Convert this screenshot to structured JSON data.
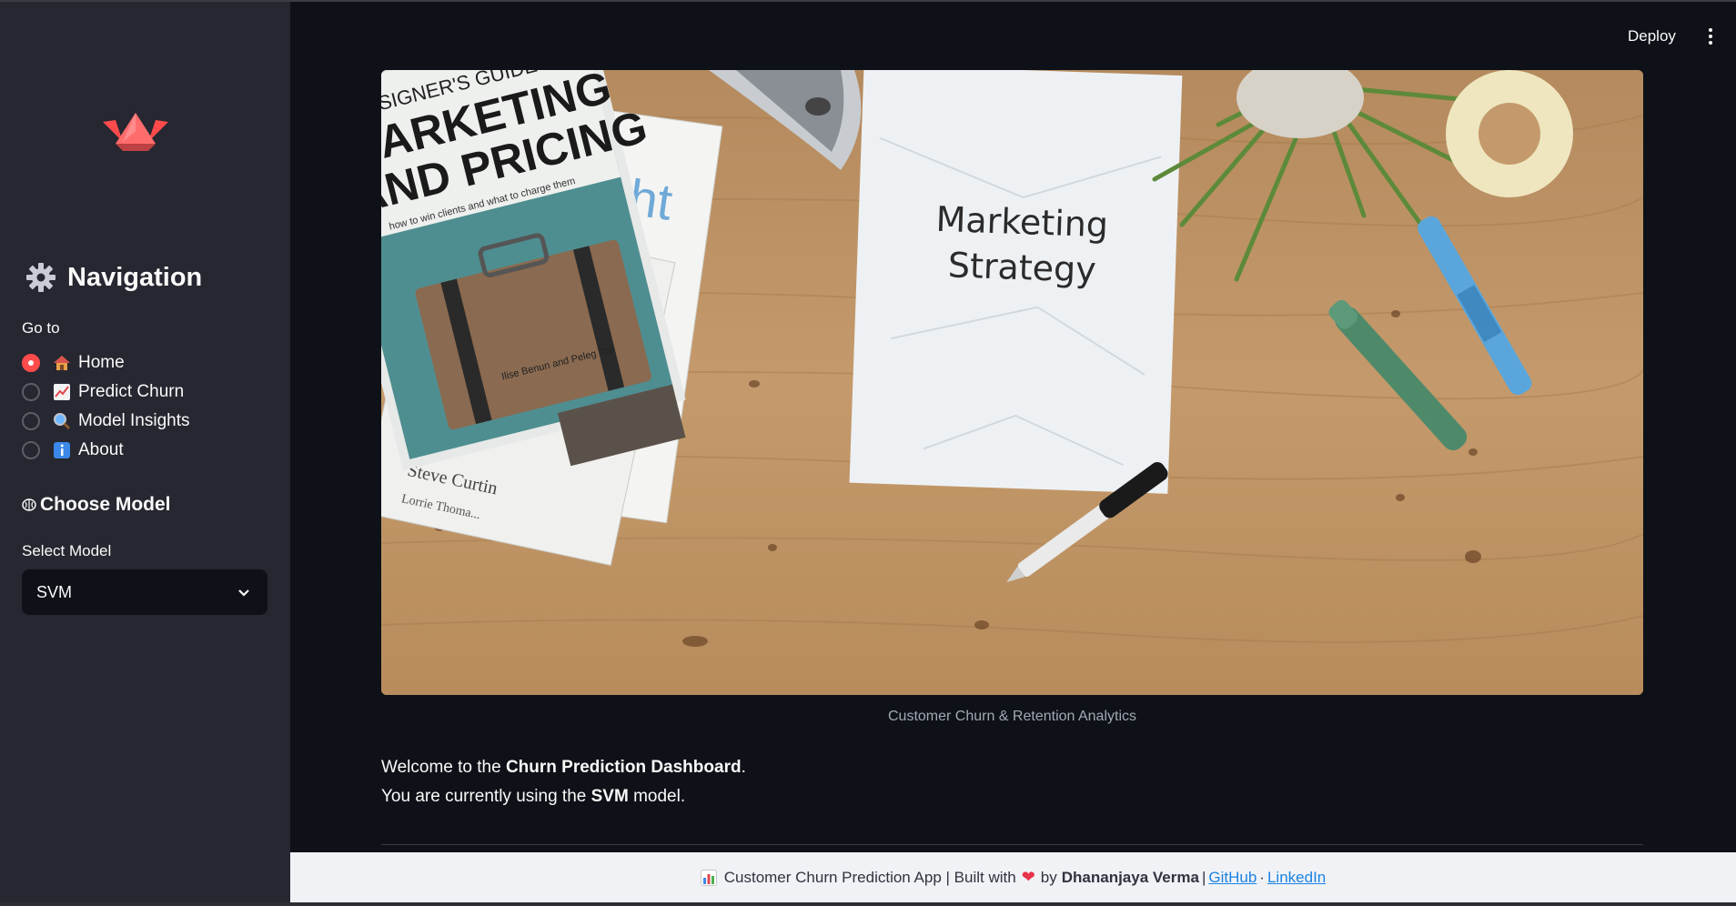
{
  "header": {
    "deploy_label": "Deploy"
  },
  "sidebar": {
    "nav_title": "Navigation",
    "goto_label": "Go to",
    "radio_items": [
      {
        "emoji": "house-icon",
        "label": "Home",
        "checked": true
      },
      {
        "emoji": "chart-increasing-icon",
        "label": "Predict Churn",
        "checked": false
      },
      {
        "emoji": "magnifier-icon",
        "label": "Model Insights",
        "checked": false
      },
      {
        "emoji": "info-icon",
        "label": "About",
        "checked": false
      }
    ],
    "choose_model_title": "Choose Model",
    "select_label": "Select Model",
    "selected_model": "SVM"
  },
  "main": {
    "hero_image": {
      "book_title_line1": "E DESIGNER'S GUIDE",
      "book_title_line2": "MARKETING",
      "book_title_line3": "AND PRICING",
      "book_subtitle": "how to win clients and what to charge them",
      "book_authors": "Ilise Benun and Peleg Top",
      "back_book_author": "Steve Curtin",
      "back_book_author2": "Lorrie Thoma...",
      "back_book_partial": "ht",
      "paper_line1": "Marketing",
      "paper_line2": "Strategy"
    },
    "caption": "Customer Churn & Retention Analytics",
    "welcome_prefix": "Welcome to the ",
    "welcome_bold": "Churn Prediction Dashboard",
    "welcome_suffix": ".",
    "using_prefix": "You are currently using the ",
    "using_bold": "SVM",
    "using_suffix": " model."
  },
  "footer": {
    "text_prefix": "Customer Churn Prediction App | Built with",
    "by_text": "by",
    "author": "Dhananjaya Verma",
    "pipe": "|",
    "github_label": "GitHub",
    "dot": "·",
    "linkedin_label": "LinkedIn"
  },
  "colors": {
    "accent": "#ff4b4b",
    "sidebar_bg": "#262730",
    "main_bg": "#0e1117",
    "footer_bg": "#f0f2f6",
    "link": "#1c83e1"
  }
}
